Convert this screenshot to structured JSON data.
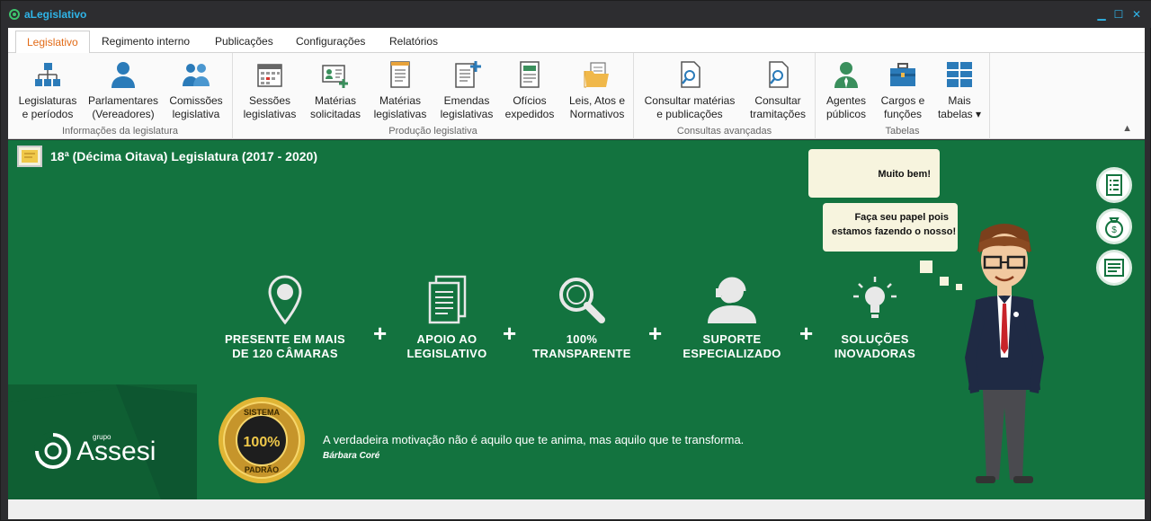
{
  "window": {
    "title": "aLegislativo"
  },
  "ribbon": {
    "tabs": [
      {
        "label": "Legislativo"
      },
      {
        "label": "Regimento interno"
      },
      {
        "label": "Publicações"
      },
      {
        "label": "Configurações"
      },
      {
        "label": "Relatórios"
      }
    ],
    "groups": [
      {
        "label": "Informações da legislatura",
        "buttons": [
          {
            "label": "Legislaturas\ne períodos",
            "icon": "org-chart-icon"
          },
          {
            "label": "Parlamentares\n(Vereadores)",
            "icon": "person-icon"
          },
          {
            "label": "Comissões\nlegislativa",
            "icon": "group-icon"
          }
        ]
      },
      {
        "label": "Produção legislativa",
        "buttons": [
          {
            "label": "Sessões\nlegislativas",
            "icon": "calendar-icon"
          },
          {
            "label": "Matérias\nsolicitadas",
            "icon": "id-card-add-icon"
          },
          {
            "label": "Matérias\nlegislativas",
            "icon": "document-icon"
          },
          {
            "label": "Emendas\nlegislativas",
            "icon": "document-add-icon"
          },
          {
            "label": "Ofícios\nexpedidos",
            "icon": "form-icon"
          },
          {
            "label": "Leis, Atos e\nNormativos",
            "icon": "folder-icon"
          }
        ]
      },
      {
        "label": "Consultas avançadas",
        "buttons": [
          {
            "label": "Consultar matérias\ne publicações",
            "icon": "search-document-icon"
          },
          {
            "label": "Consultar\ntramitações",
            "icon": "search-document-icon"
          }
        ]
      },
      {
        "label": "Tabelas",
        "buttons": [
          {
            "label": "Agentes\npúblicos",
            "icon": "agent-icon"
          },
          {
            "label": "Cargos e\nfunções",
            "icon": "briefcase-icon"
          },
          {
            "label": "Mais\ntabelas ▾",
            "icon": "table-icon"
          }
        ]
      }
    ]
  },
  "main": {
    "legislature_title": "18ª (Décima Oitava) Legislatura (2017 - 2020)",
    "features": [
      {
        "label": "PRESENTE EM MAIS\nDE 120 CÂMARAS",
        "icon": "location-pin-icon"
      },
      {
        "label": "APOIO AO\nLEGISLATIVO",
        "icon": "documents-icon"
      },
      {
        "label": "100%\nTRANSPARENTE",
        "icon": "magnifier-icon"
      },
      {
        "label": "SUPORTE\nESPECIALIZADO",
        "icon": "headset-support-icon"
      },
      {
        "label": "SOLUÇÕES\nINOVADORAS",
        "icon": "lightbulb-icon"
      }
    ],
    "plus_symbol": "+",
    "bubbles": [
      {
        "text": "Muito bem!"
      },
      {
        "text": "Faça seu papel pois\nestamos fazendo o nosso!"
      }
    ],
    "quote": "A verdadeira motivação não é aquilo que te anima, mas aquilo que te transforma.",
    "quote_author": "Bárbara Coré",
    "brand": {
      "prefix": "grupo",
      "name": "Assesi"
    },
    "seal": {
      "top": "SISTEMA",
      "center": "100%",
      "bottom": "PADRÃO"
    }
  },
  "colors": {
    "accent": "#e26b17",
    "main_green": "#13733f",
    "title_blue": "#2fb4e8"
  }
}
